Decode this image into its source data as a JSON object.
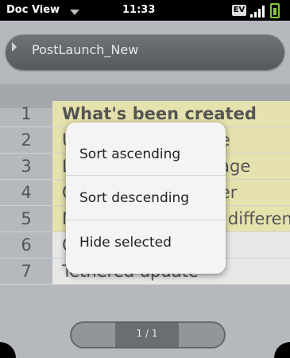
{
  "status": {
    "app_name": "Doc View",
    "time": "11:33",
    "ev_badge": "EV"
  },
  "document": {
    "title": "PostLaunch_New"
  },
  "rows": [
    {
      "num": "1",
      "text": "What's been created"
    },
    {
      "num": "2",
      "text": "Using the card page"
    },
    {
      "num": "3",
      "text": "Launching a web page"
    },
    {
      "num": "4",
      "text": "Opening the browser"
    },
    {
      "num": "5",
      "text": "Moving an app to a different page"
    },
    {
      "num": "6",
      "text": "Over the air update"
    },
    {
      "num": "7",
      "text": "Tethered update"
    }
  ],
  "menu": {
    "sort_ascending": "Sort ascending",
    "sort_descending": "Sort descending",
    "hide_selected": "Hide selected"
  },
  "pager": {
    "label": "1 / 1"
  }
}
